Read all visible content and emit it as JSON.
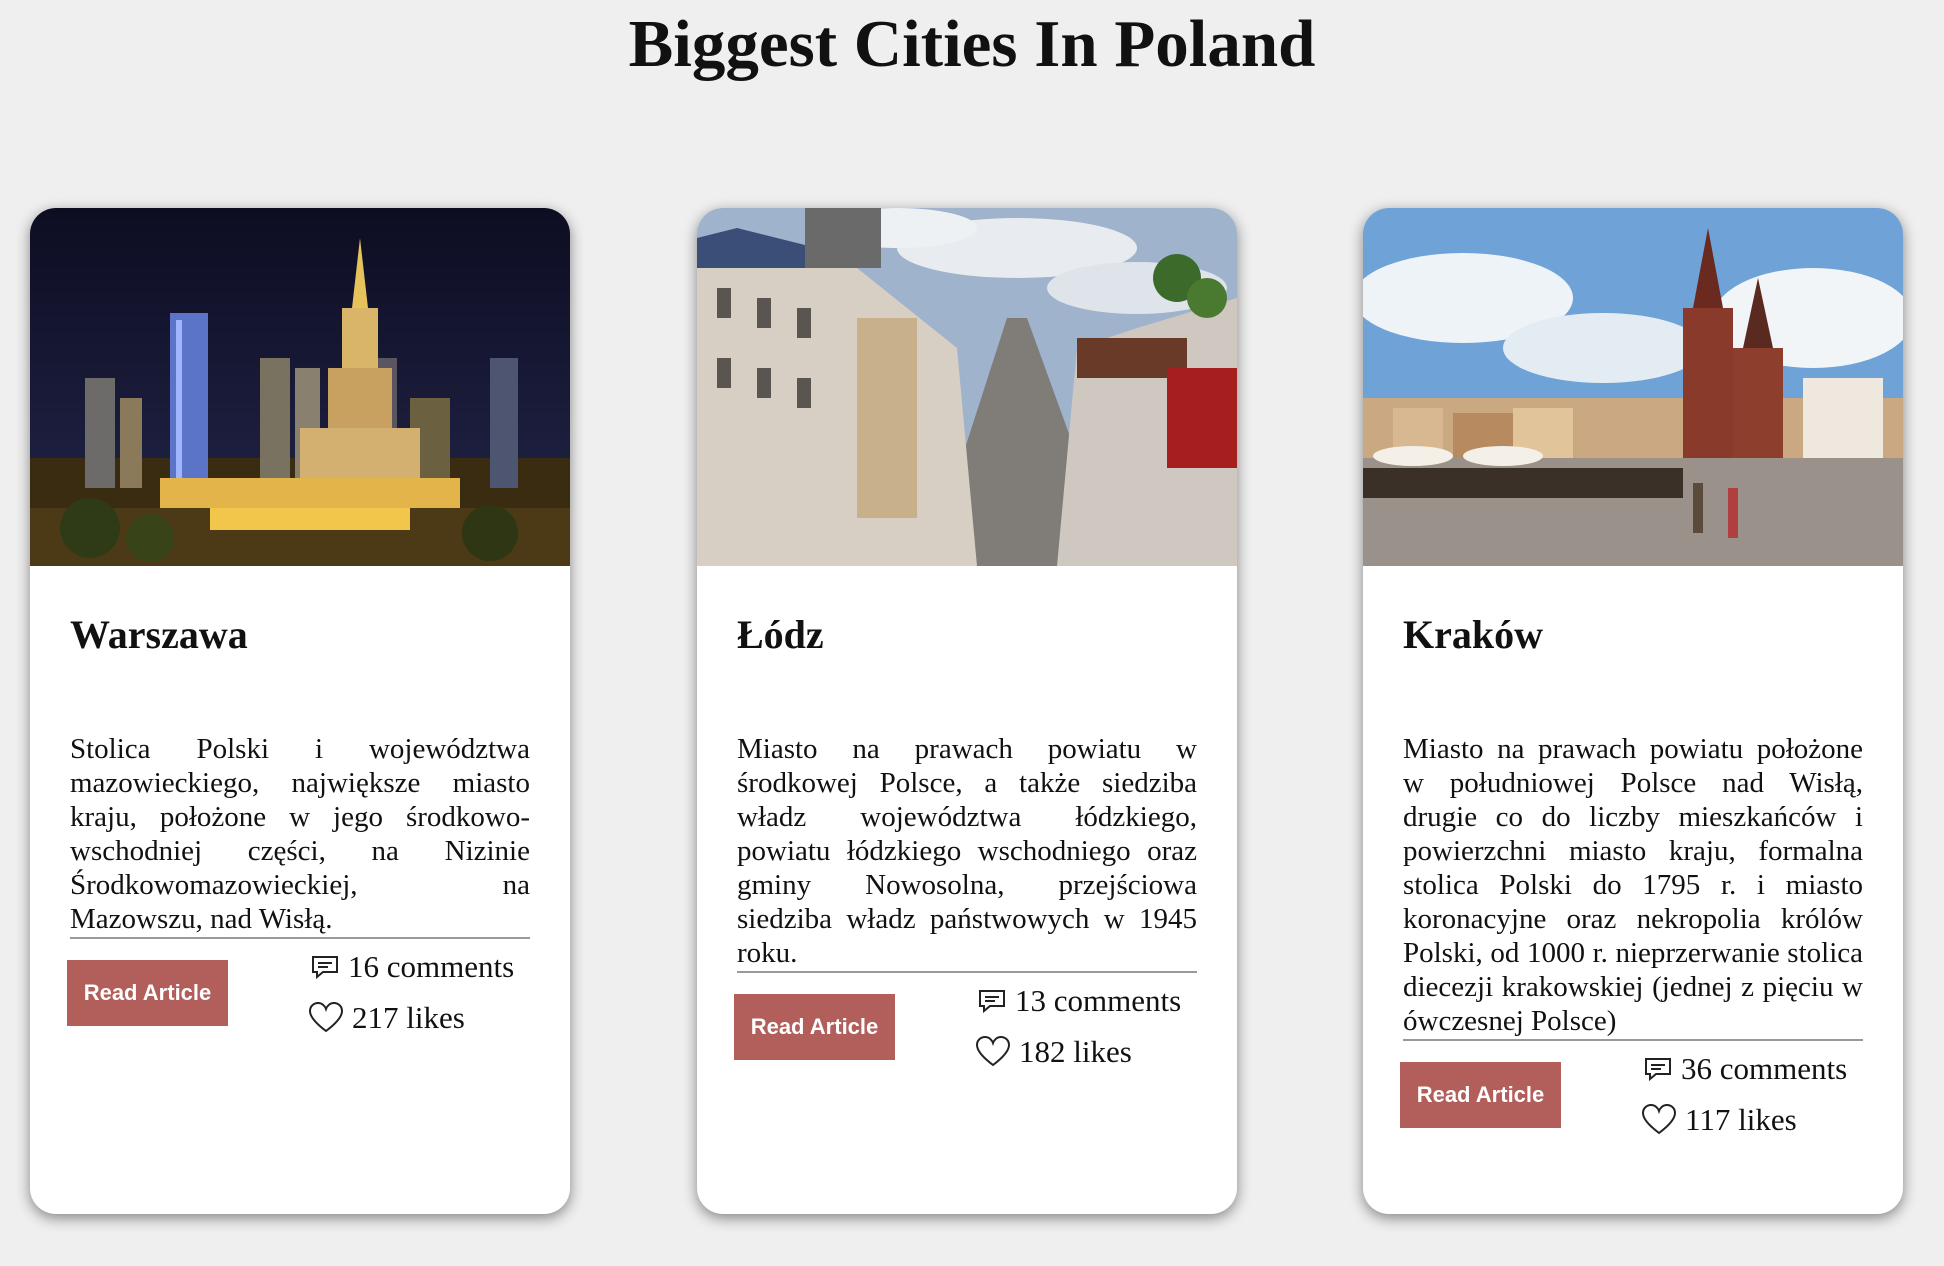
{
  "page": {
    "title": "Biggest Cities In Poland"
  },
  "cards": [
    {
      "city": "Warszawa",
      "image": "warsaw-night-skyline-photo",
      "description": "Stolica Polski i województwa mazowieckiego, największe miasto kraju, położone w jego środkowo-wschodniej części, na Nizinie Środkowomazowieckiej, na Mazowszu, nad Wisłą.",
      "button_label": "Read Article",
      "comments": "16 comments",
      "likes": "217 likes"
    },
    {
      "city": "Łódz",
      "image": "lodz-piotrkowska-street-photo",
      "description": "Miasto na prawach powiatu w środkowej Polsce, a także siedziba władz województwa łódzkiego, powiatu łódzkiego wschodniego oraz gminy Nowosolna, przejściowa siedziba władz państwowych w 1945 roku.",
      "button_label": "Read Article",
      "comments": "13 comments",
      "likes": "182 likes"
    },
    {
      "city": "Kraków",
      "image": "krakow-main-square-photo",
      "description": "Miasto na prawach powiatu położone w południowej Polsce nad Wisłą, drugie co do liczby mieszkańców i powierzchni miasto kraju, formalna stolica Polski do 1795 r. i miasto koronacyjne oraz nekropolia królów Polski, od 1000 r. nieprzerwanie stolica diecezji krakowskiej (jednej z pięciu w ówczesnej Polsce)",
      "button_label": "Read Article",
      "comments": "36 comments",
      "likes": "117 likes"
    }
  ],
  "icons": {
    "comments": "comment-icon",
    "likes": "heart-icon"
  },
  "colors": {
    "background": "#efefef",
    "button": "#b25e5b",
    "card": "#ffffff"
  }
}
